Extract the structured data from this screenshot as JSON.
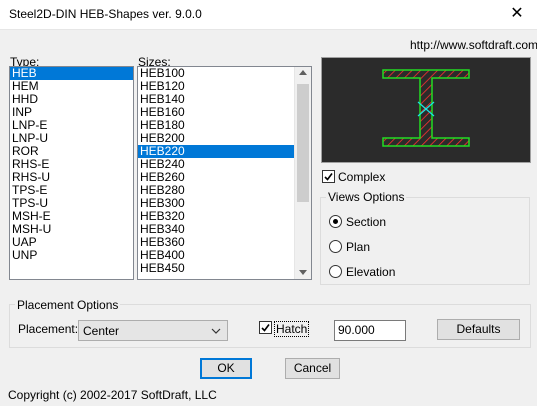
{
  "window": {
    "title": "Steel2D-DIN HEB-Shapes ver. 9.0.0",
    "close_glyph": "✕",
    "url": "http://www.softdraft.com"
  },
  "type": {
    "label": "Type:",
    "items": [
      "HEB",
      "HEM",
      "HHD",
      "INP",
      "LNP-E",
      "LNP-U",
      "ROR",
      "RHS-E",
      "RHS-U",
      "TPS-E",
      "TPS-U",
      "MSH-E",
      "MSH-U",
      "UAP",
      "UNP"
    ],
    "selected_index": 0
  },
  "sizes": {
    "label": "Sizes:",
    "items": [
      "HEB100",
      "HEB120",
      "HEB140",
      "HEB160",
      "HEB180",
      "HEB200",
      "HEB220",
      "HEB240",
      "HEB260",
      "HEB280",
      "HEB300",
      "HEB320",
      "HEB340",
      "HEB360",
      "HEB400",
      "HEB450"
    ],
    "selected_index": 6,
    "scroll_position": 0.35
  },
  "complex": {
    "label": "Complex",
    "checked": true
  },
  "views": {
    "label": "Views Options",
    "options": [
      "Section",
      "Plan",
      "Elevation"
    ],
    "selected": "Section"
  },
  "placement": {
    "group_label": "Placement Options",
    "label": "Placement:",
    "value": "Center",
    "hatch_label": "Hatch",
    "hatch_checked": true,
    "angle_value": "90.000",
    "defaults_label": "Defaults"
  },
  "ok_label": "OK",
  "cancel_label": "Cancel",
  "copyright": "Copyright (c) 2002-2017 SoftDraft, LLC",
  "colors": {
    "selection": "#0078d7",
    "preview_bg": "#2b2b2b",
    "shape_green": "#22dd22",
    "hatch_red": "#ff3030",
    "axis_cyan": "#19e6e6"
  }
}
